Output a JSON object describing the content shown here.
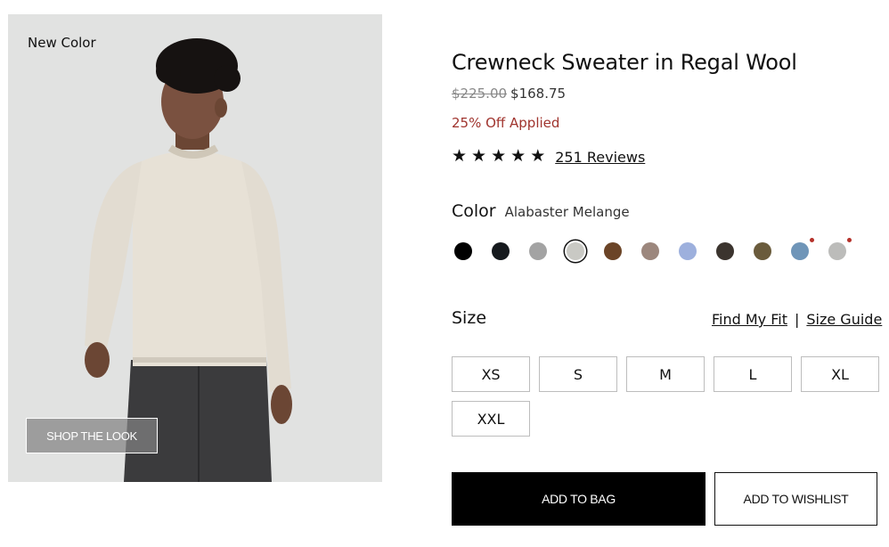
{
  "image": {
    "badge": "New Color",
    "shop_the_look": "SHOP THE LOOK"
  },
  "product": {
    "title": "Crewneck Sweater in Regal Wool",
    "price_original": "$225.00",
    "price_sale": "$168.75",
    "discount": "25% Off Applied",
    "rating": {
      "stars": 5,
      "reviews_link": "251 Reviews"
    }
  },
  "color": {
    "label": "Color",
    "selected": "Alabaster Melange",
    "swatches": [
      {
        "color": "#000000",
        "new": false,
        "selected": false
      },
      {
        "color": "#161a1e",
        "new": false,
        "selected": false
      },
      {
        "color": "#a3a3a3",
        "new": false,
        "selected": false
      },
      {
        "color": "#c9c9c4",
        "new": false,
        "selected": true
      },
      {
        "color": "#6b4427",
        "new": false,
        "selected": false
      },
      {
        "color": "#9c877d",
        "new": false,
        "selected": false
      },
      {
        "color": "#9db0dd",
        "new": false,
        "selected": false
      },
      {
        "color": "#3b342e",
        "new": false,
        "selected": false
      },
      {
        "color": "#6a5b3c",
        "new": false,
        "selected": false
      },
      {
        "color": "#6f95b8",
        "new": true,
        "selected": false
      },
      {
        "color": "#bcbcba",
        "new": true,
        "selected": false
      }
    ]
  },
  "size": {
    "label": "Size",
    "find_my_fit": "Find My Fit",
    "separator": "|",
    "size_guide": "Size Guide",
    "options": [
      "XS",
      "S",
      "M",
      "L",
      "XL",
      "XXL"
    ]
  },
  "actions": {
    "add_to_bag": "ADD TO BAG",
    "add_to_wishlist": "ADD TO WISHLIST"
  }
}
